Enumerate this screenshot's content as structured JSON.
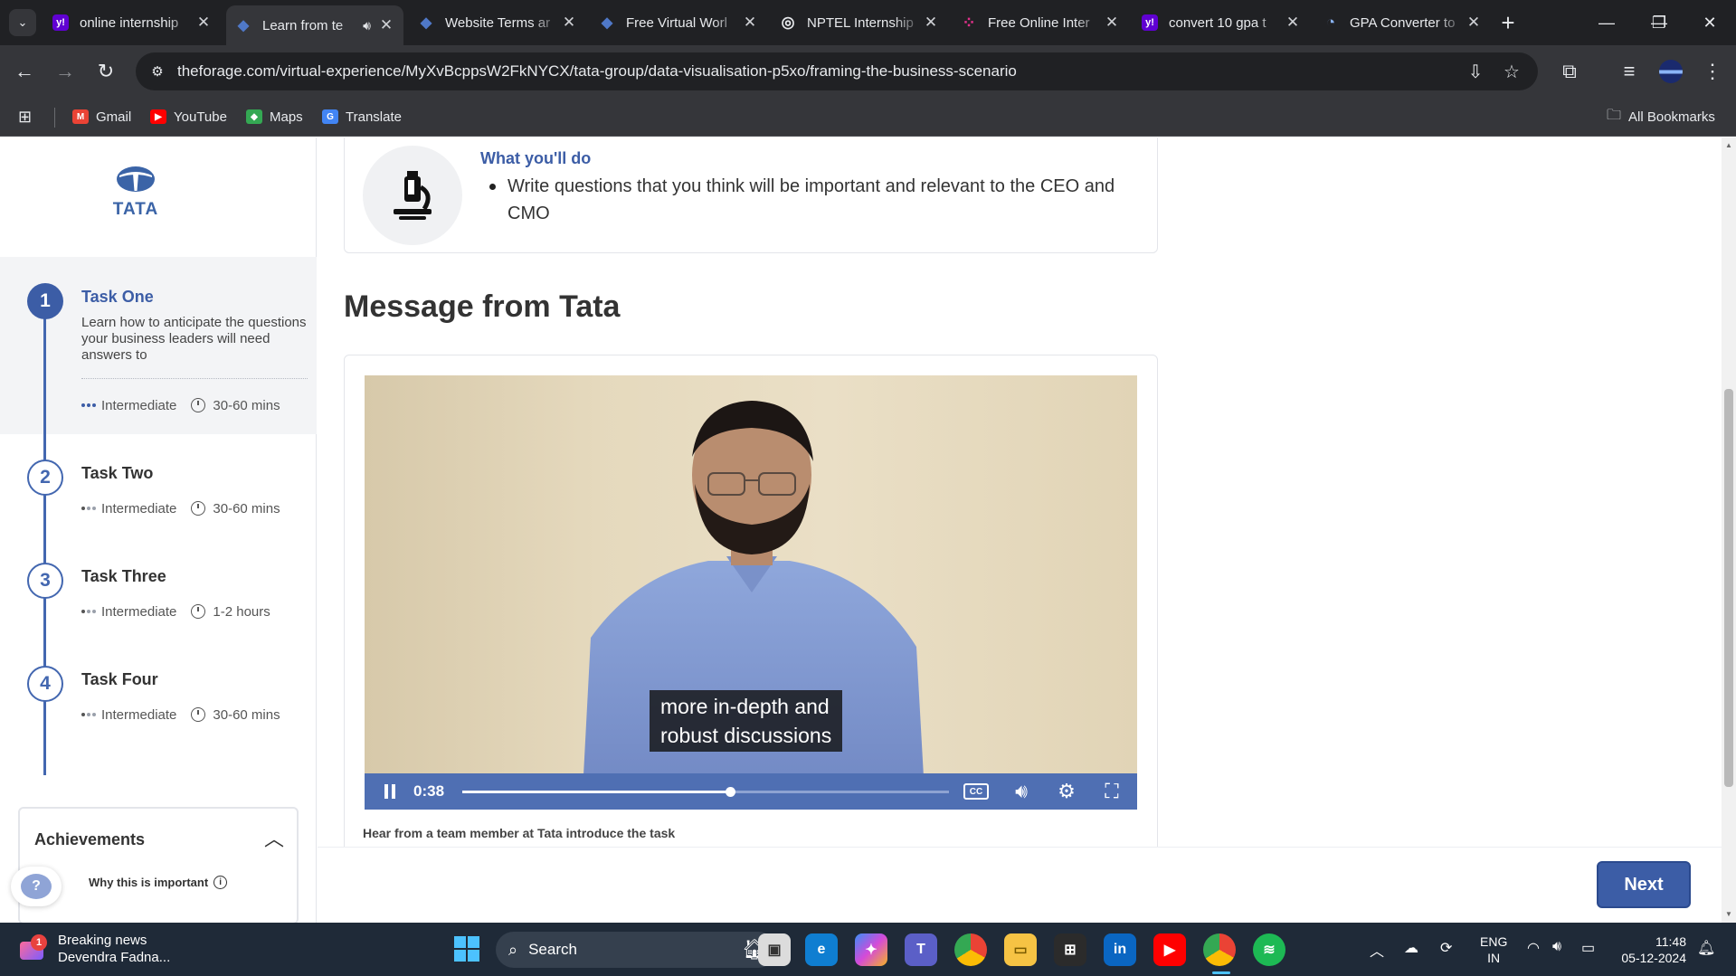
{
  "browser": {
    "tabs": [
      {
        "title": "online internship",
        "favicon_color": "#6001d2",
        "favicon": "y!"
      },
      {
        "title": "Learn from te",
        "favicon_color": "#3b64a7",
        "favicon": "◆",
        "active": true
      },
      {
        "title": "Website Terms ar",
        "favicon_color": "#3b64a7",
        "favicon": "◆"
      },
      {
        "title": "Free Virtual Worl",
        "favicon_color": "#3b64a7",
        "favicon": "◆"
      },
      {
        "title": "NPTEL Internship",
        "favicon_color": "#5f6368",
        "favicon": "◎"
      },
      {
        "title": "Free Online Inter",
        "favicon_color": "#e0318a",
        "favicon": "⁘"
      },
      {
        "title": "convert 10 gpa t",
        "favicon_color": "#6001d2",
        "favicon": "y!"
      },
      {
        "title": "GPA Converter to",
        "favicon_color": "#4a90d9",
        "favicon": "◔"
      }
    ],
    "url": "theforage.com/virtual-experience/MyXvBcppsW2FkNYCX/tata-group/data-visualisation-p5xo/framing-the-business-scenario",
    "bookmarks": [
      "Gmail",
      "YouTube",
      "Maps",
      "Translate"
    ],
    "all_bookmarks": "All Bookmarks"
  },
  "sidebar": {
    "logo_text": "TATA",
    "tasks": [
      {
        "number": "1",
        "title": "Task One",
        "description": "Learn how to anticipate the questions your business leaders will need answers to",
        "level": "Intermediate",
        "duration": "30-60 mins"
      },
      {
        "number": "2",
        "title": "Task Two",
        "level": "Intermediate",
        "duration": "30-60 mins"
      },
      {
        "number": "3",
        "title": "Task Three",
        "level": "Intermediate",
        "duration": "1-2 hours"
      },
      {
        "number": "4",
        "title": "Task Four",
        "level": "Intermediate",
        "duration": "30-60 mins"
      }
    ],
    "achievements": "Achievements",
    "why_important": "Why this is important",
    "help": "?"
  },
  "main": {
    "what_youll_do_title": "What you'll do",
    "what_youll_do_item": "Write questions that you think will be important and relevant to the CEO and CMO",
    "section_title": "Message from Tata",
    "video": {
      "caption_line1": "more in-depth and",
      "caption_line2": "robust discussions",
      "time": "0:38",
      "progress": 0.55,
      "description": "Hear from a team member at Tata introduce the task"
    },
    "next_label": "Next"
  },
  "taskbar": {
    "news_title": "Breaking news",
    "news_sub": "Devendra Fadna...",
    "news_badge": "1",
    "search": "Search",
    "lang1": "ENG",
    "lang2": "IN",
    "time": "11:48",
    "date": "05-12-2024"
  }
}
